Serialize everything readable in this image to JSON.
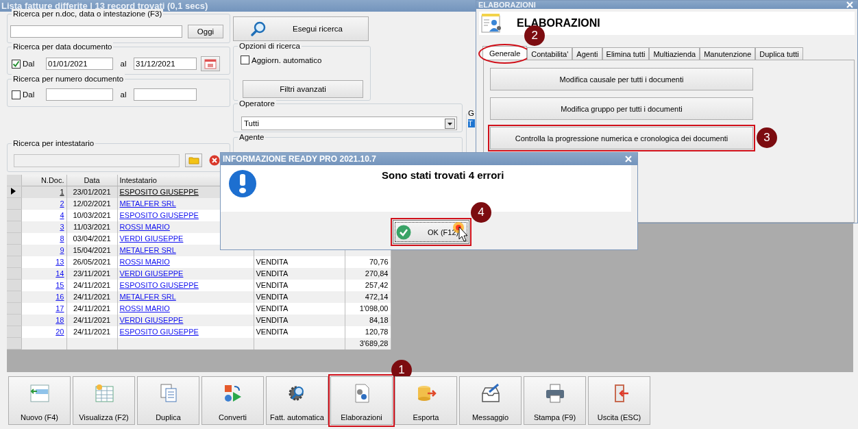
{
  "main_window": {
    "title": "Lista fatture differite | 13 record trovati (0,1 secs)"
  },
  "search_text": {
    "label": "Ricerca per n.doc, data o intestazione (F3)",
    "today_button": "Oggi"
  },
  "date_search": {
    "label": "Ricerca per data documento",
    "checkbox_label": "Dal",
    "checked": true,
    "from": "01/01/2021",
    "to_label": "al",
    "to": "31/12/2021"
  },
  "number_search": {
    "label": "Ricerca per numero documento",
    "checkbox_label": "Dal",
    "checked": false,
    "to_label": "al"
  },
  "holder_search": {
    "label": "Ricerca per intestatario"
  },
  "search_button": "Esegui ricerca",
  "search_options": {
    "label": "Opzioni di ricerca",
    "auto_update": {
      "label": "Aggiorn. automatico",
      "checked": false
    },
    "advanced_button": "Filtri avanzati"
  },
  "operator": {
    "label": "Operatore",
    "value": "Tutti"
  },
  "agent": {
    "label": "Agente"
  },
  "group_3": {
    "label": "G",
    "items": [
      "T"
    ]
  },
  "table": {
    "columns": [
      "N.Doc.",
      "Data",
      "Intestatario"
    ],
    "rows": [
      {
        "number": "1",
        "date": "23/01/2021",
        "holder": "ESPOSITO GIUSEPPE",
        "selected": true
      },
      {
        "number": "2",
        "date": "12/02/2021",
        "holder": "METALFER SRL",
        "selected": false
      },
      {
        "number": "4",
        "date": "10/03/2021",
        "holder": "ESPOSITO GIUSEPPE",
        "selected": false
      },
      {
        "number": "3",
        "date": "11/03/2021",
        "holder": "ROSSI MARIO",
        "selected": false
      },
      {
        "number": "8",
        "date": "03/04/2021",
        "holder": "VERDI GIUSEPPE",
        "selected": false
      },
      {
        "number": "9",
        "date": "15/04/2021",
        "holder": "METALFER SRL",
        "selected": false
      },
      {
        "number": "13",
        "date": "26/05/2021",
        "holder": "ROSSI MARIO",
        "type": "VENDITA",
        "amount": "70,76",
        "selected": false
      },
      {
        "number": "14",
        "date": "23/11/2021",
        "holder": "VERDI GIUSEPPE",
        "type": "VENDITA",
        "amount": "270,84",
        "selected": false
      },
      {
        "number": "15",
        "date": "24/11/2021",
        "holder": "ESPOSITO GIUSEPPE",
        "type": "VENDITA",
        "amount": "257,42",
        "selected": false
      },
      {
        "number": "16",
        "date": "24/11/2021",
        "holder": "METALFER SRL",
        "type": "VENDITA",
        "amount": "472,14",
        "selected": false
      },
      {
        "number": "17",
        "date": "24/11/2021",
        "holder": "ROSSI MARIO",
        "type": "VENDITA",
        "amount": "1'098,00",
        "selected": false
      },
      {
        "number": "18",
        "date": "24/11/2021",
        "holder": "VERDI GIUSEPPE",
        "type": "VENDITA",
        "amount": "84,18",
        "selected": false
      },
      {
        "number": "20",
        "date": "24/11/2021",
        "holder": "ESPOSITO GIUSEPPE",
        "type": "VENDITA",
        "amount": "120,78",
        "selected": false
      }
    ],
    "total": "3'689,28"
  },
  "toolbar": [
    {
      "label": "Nuovo (F4)"
    },
    {
      "label": "Visualizza (F2)"
    },
    {
      "label": "Duplica"
    },
    {
      "label": "Converti"
    },
    {
      "label": "Fatt. automatica"
    },
    {
      "label": "Elaborazioni",
      "callout": "1"
    },
    {
      "label": "Esporta"
    },
    {
      "label": "Messaggio"
    },
    {
      "label": "Stampa (F9)"
    },
    {
      "label": "Uscita (ESC)"
    }
  ],
  "processing_window": {
    "title": "ELABORAZIONI",
    "heading": "ELABORAZIONI",
    "tabs": [
      {
        "label": "Generale",
        "selected": true,
        "callout": "2"
      },
      {
        "label": "Contabilita'",
        "selected": false
      },
      {
        "label": "Agenti",
        "selected": false
      },
      {
        "label": "Elimina tutti",
        "selected": false
      },
      {
        "label": "Multiazienda",
        "selected": false
      },
      {
        "label": "Manutenzione",
        "selected": false
      },
      {
        "label": "Duplica tutti",
        "selected": false
      }
    ],
    "actions": [
      {
        "label": "Modifica causale per tutti i documenti"
      },
      {
        "label": "Modifica gruppo per tutti i documenti"
      },
      {
        "label": "Controlla la progressione numerica e cronologica dei documenti",
        "callout": "3"
      }
    ]
  },
  "dialog": {
    "title": "INFORMAZIONE READY PRO 2021.10.7",
    "message": "Sono stati trovati 4 errori",
    "ok_button": {
      "label": "OK (F12)",
      "callout": "4"
    }
  }
}
